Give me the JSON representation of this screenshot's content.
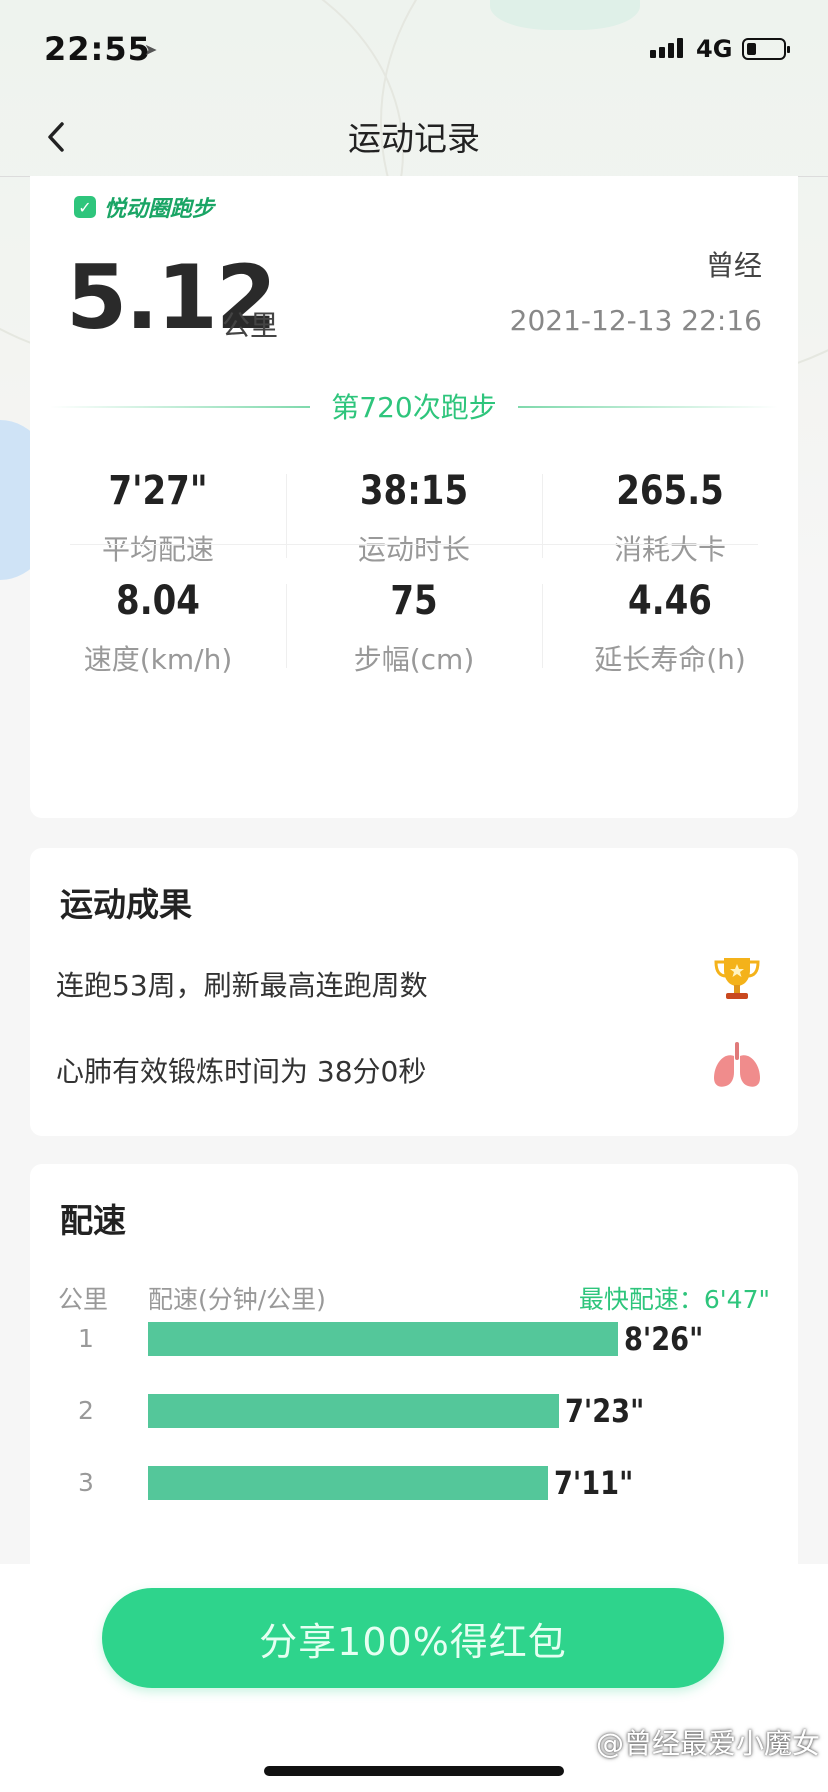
{
  "status_bar": {
    "time": "22:55",
    "network": "4G",
    "battery_percent": 20
  },
  "nav": {
    "title": "运动记录"
  },
  "summary": {
    "brand": "悦动圈跑步",
    "user": "曾经",
    "distance": "5.12",
    "distance_unit": "公里",
    "datetime": "2021-12-13 22:16",
    "run_count": "第720次跑步"
  },
  "stats": [
    {
      "value": "7'27\"",
      "label": "平均配速"
    },
    {
      "value": "38:15",
      "label": "运动时长"
    },
    {
      "value": "265.5",
      "label": "消耗大卡"
    },
    {
      "value": "8.04",
      "label": "速度(km/h)"
    },
    {
      "value": "75",
      "label": "步幅(cm)"
    },
    {
      "value": "4.46",
      "label": "延长寿命(h)"
    }
  ],
  "achievements": {
    "title": "运动成果",
    "items": [
      {
        "text": "连跑53周，刷新最高连跑周数",
        "icon": "trophy-icon"
      },
      {
        "text": "心肺有效锻炼时间为 38分0秒",
        "icon": "lungs-icon"
      }
    ]
  },
  "pace": {
    "title": "配速",
    "col_km": "公里",
    "col_pace": "配速(分钟/公里)",
    "fastest": "最快配速：6'47\"",
    "rows": [
      {
        "km": "1",
        "pace": "8'26\"",
        "seconds": 506
      },
      {
        "km": "2",
        "pace": "7'23\"",
        "seconds": 443
      },
      {
        "km": "3",
        "pace": "7'11\"",
        "seconds": 431
      }
    ]
  },
  "share_button": "分享100%得红包",
  "watermark": "@曾经最爱小魔女",
  "colors": {
    "accent": "#2ec57c",
    "bar": "#54c79a",
    "button": "#2ed48c"
  }
}
